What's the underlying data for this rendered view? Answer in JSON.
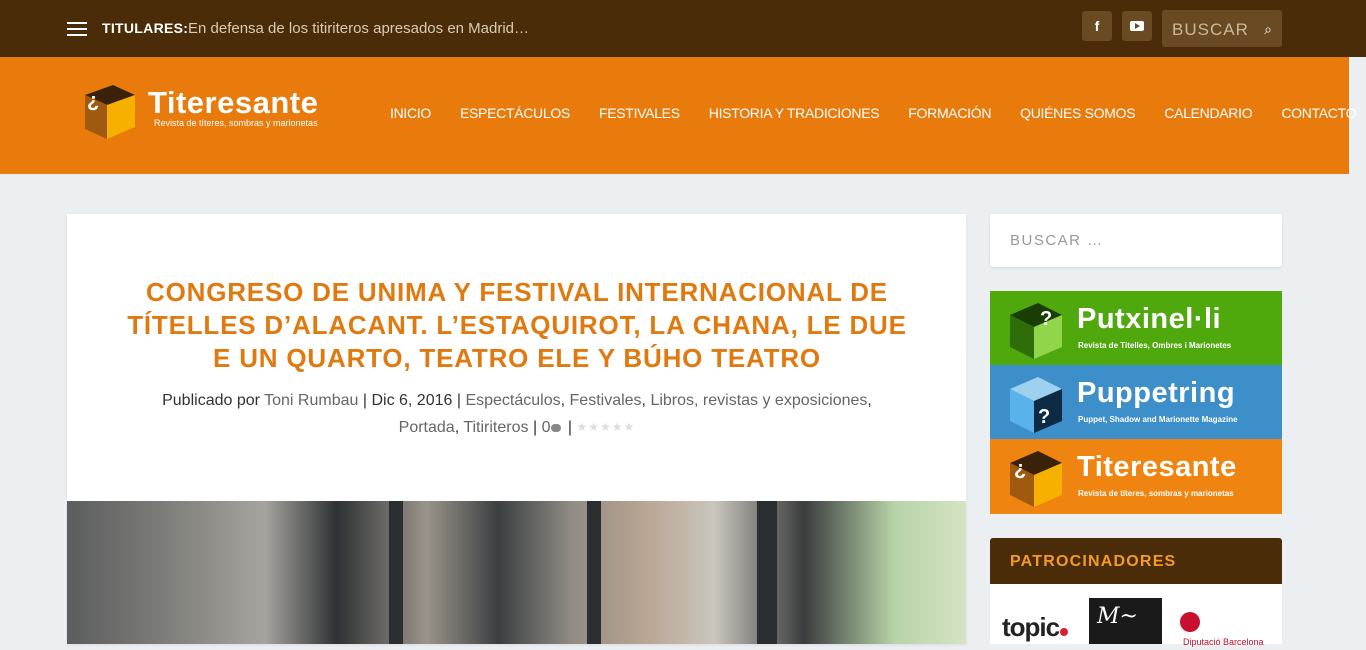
{
  "topbar": {
    "ticker_label": "TITULARES:",
    "ticker_text": "En defensa de los titiriteros apresados en Madrid…",
    "social": [
      "facebook-icon",
      "youtube-icon"
    ],
    "search_placeholder": "BUSCAR"
  },
  "header": {
    "logo_title": "Titeresante",
    "logo_tagline": "Revista de títeres, sombras y marionetas",
    "nav": [
      "INICIO",
      "ESPECTÁCULOS",
      "FESTIVALES",
      "HISTORIA Y TRADICIONES",
      "FORMACIÓN",
      "QUIÉNES SOMOS",
      "CALENDARIO",
      "CONTACTO"
    ]
  },
  "post": {
    "title": "CONGRESO DE UNIMA Y FESTIVAL INTERNACIONAL DE TÍTELLES D’ALACANT. L’ESTAQUIROT, LA CHANA, LE DUE E UN QUARTO, TEATRO ELE Y BÚHO TEATRO",
    "meta_prefix": "Publicado por",
    "author": "Toni Rumbau",
    "sep": "|",
    "date": "Dic 6, 2016",
    "categories": [
      "Espectáculos",
      "Festivales",
      "Libros, revistas y exposiciones",
      "Portada",
      "Titiriteros"
    ],
    "comments": "0",
    "stars": "★★★★★"
  },
  "sidebar": {
    "search_placeholder": "BUSCAR …",
    "banners": [
      {
        "title": "Putxinel·li",
        "subtitle": "Revista de Titelles, Ombres i Marionetes",
        "color": "#4fa90d"
      },
      {
        "title": "Puppetring",
        "subtitle": "Puppet, Shadow and Marionette Magazine",
        "color": "#3d8fc9"
      },
      {
        "title": "Titeresante",
        "subtitle": "Revista de títeres, sombras y marionetas",
        "color": "#f08410"
      }
    ],
    "sponsors_title": "PATROCINADORES",
    "sponsors": [
      "topic",
      "Diputació Barcelona"
    ]
  },
  "colors": {
    "topbar": "#4a2c08",
    "header": "#e87b0c",
    "title": "#e07a10"
  }
}
